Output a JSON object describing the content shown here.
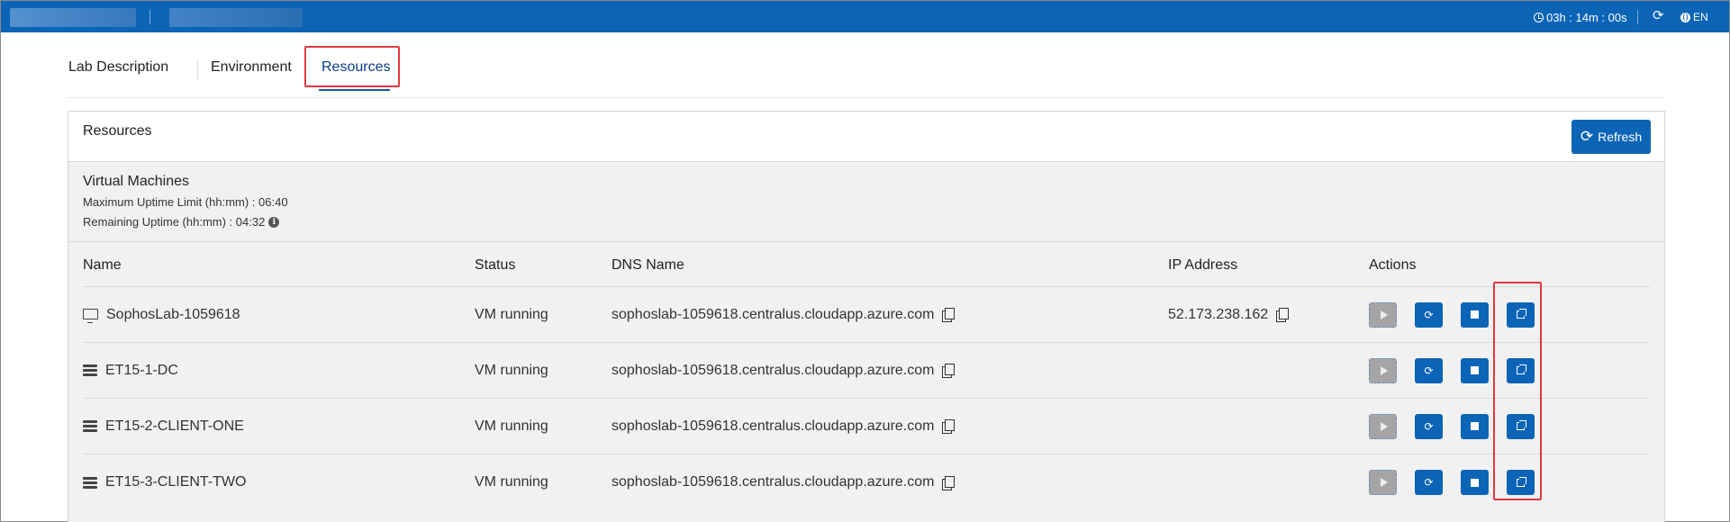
{
  "header": {
    "timer": "03h : 14m : 00s",
    "timer_icon": "clock-icon",
    "refresh_icon": "refresh-icon",
    "language": "EN",
    "language_icon": "globe-icon"
  },
  "tabs": [
    {
      "label": "Lab Description"
    },
    {
      "label": "Environment"
    },
    {
      "label": "Resources",
      "active": true
    }
  ],
  "panel": {
    "title": "Resources",
    "refresh_label": "Refresh"
  },
  "vm_section": {
    "title": "Virtual Machines",
    "max_uptime": "Maximum Uptime Limit (hh:mm) : 06:40",
    "remaining_uptime": "Remaining Uptime (hh:mm) : 04:32",
    "info_icon": "i"
  },
  "table": {
    "columns": [
      "Name",
      "Status",
      "DNS Name",
      "IP Address",
      "Actions"
    ],
    "rows": [
      {
        "icon": "monitor-icon",
        "name": "SophosLab-1059618",
        "status": "VM running",
        "dns": "sophoslab-1059618.centralus.cloudapp.azure.com",
        "ip": "52.173.238.162"
      },
      {
        "icon": "server-icon",
        "name": "ET15-1-DC",
        "status": "VM running",
        "dns": "sophoslab-1059618.centralus.cloudapp.azure.com",
        "ip": ""
      },
      {
        "icon": "server-icon",
        "name": "ET15-2-CLIENT-ONE",
        "status": "VM running",
        "dns": "sophoslab-1059618.centralus.cloudapp.azure.com",
        "ip": ""
      },
      {
        "icon": "server-icon",
        "name": "ET15-3-CLIENT-TWO",
        "status": "VM running",
        "dns": "sophoslab-1059618.centralus.cloudapp.azure.com",
        "ip": ""
      }
    ]
  },
  "colors": {
    "brand_blue": "#0c64b6",
    "highlight_red": "#e0393e"
  }
}
